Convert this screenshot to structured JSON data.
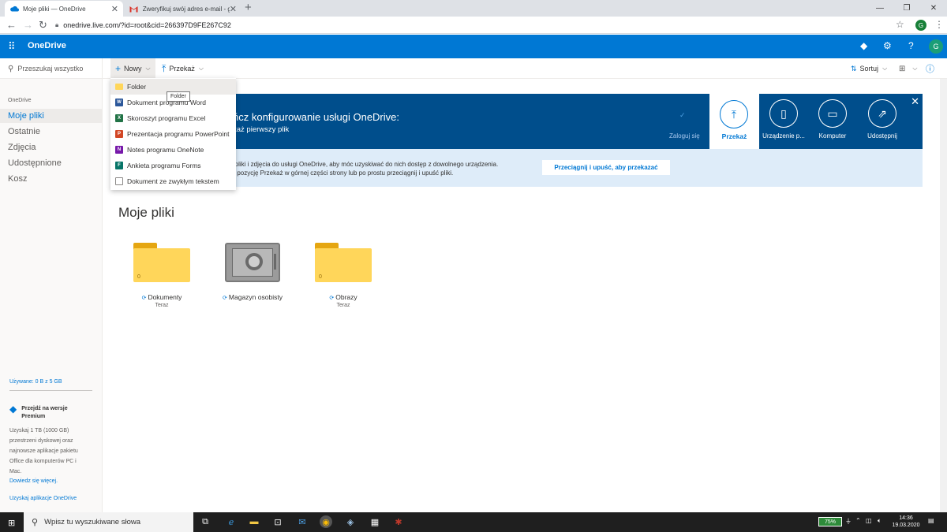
{
  "browser": {
    "tabs": [
      {
        "title": "Moje pliki — OneDrive",
        "close": "✕"
      },
      {
        "title": "Zweryfikuj swój adres e-mail - g",
        "close": "✕"
      }
    ],
    "new_tab": "+",
    "url": "onedrive.live.com/?id=root&cid=266397D9FE267C92",
    "profile_initial": "G"
  },
  "header": {
    "title": "OneDrive",
    "help": "?",
    "avatar": "G"
  },
  "commandbar": {
    "search_placeholder": "Przeszukaj wszystko",
    "new_label": "Nowy",
    "upload_label": "Przekaż",
    "sort_label": "Sortuj"
  },
  "new_menu": {
    "items": [
      {
        "label": "Folder",
        "icon": "folder-icon"
      },
      {
        "label": "Dokument programu Word",
        "icon": "word-icon"
      },
      {
        "label": "Skoroszyt programu Excel",
        "icon": "excel-icon"
      },
      {
        "label": "Prezentacja programu PowerPoint",
        "icon": "powerpoint-icon"
      },
      {
        "label": "Notes programu OneNote",
        "icon": "onenote-icon"
      },
      {
        "label": "Ankieta programu Forms",
        "icon": "forms-icon"
      },
      {
        "label": "Dokument ze zwykłym tekstem",
        "icon": "text-document-icon"
      }
    ],
    "tooltip": "Folder"
  },
  "sidebar": {
    "heading": "OneDrive",
    "items": [
      {
        "label": "Moje pliki",
        "active": true
      },
      {
        "label": "Ostatnie",
        "active": false
      },
      {
        "label": "Zdjęcia",
        "active": false
      },
      {
        "label": "Udostępnione",
        "active": false
      },
      {
        "label": "Kosz",
        "active": false
      }
    ],
    "usage": "Używane: 0 B z 5 GB",
    "premium_title": "Przejdź na wersje Premium",
    "premium_desc": "Uzyskaj 1 TB (1000 GB) przestrzeni dyskowej oraz najnowsze aplikacje pakietu Office dla komputerów PC i Mac.",
    "premium_link": "Dowiedz się więcej.",
    "apps_link": "Uzyskaj aplikacje OneDrive"
  },
  "banner": {
    "title": "ńcz konfigurowanie usługi OneDrive:",
    "subtitle": "każ pierwszy plik",
    "login": "Zaloguj się",
    "steps": [
      {
        "label": "Przekaż",
        "icon": "upload-arrow-icon"
      },
      {
        "label": "Urządzenie p...",
        "icon": "phone-icon"
      },
      {
        "label": "Komputer",
        "icon": "monitor-icon"
      },
      {
        "label": "Udostępnij",
        "icon": "share-icon"
      }
    ],
    "info_line1": "aż pliki i zdjęcia do usługi OneDrive, aby móc uzyskiwać do nich dostęp z dowolnego urządzenia.",
    "info_line2": "erz pozycję Przekaż w górnej części strony lub po prostu przeciągnij i upuść pliki.",
    "info_button": "Przeciągnij i upuść, aby przekazać"
  },
  "main": {
    "title": "Moje pliki",
    "items": [
      {
        "name": "Dokumenty",
        "date": "Teraz",
        "count": "0",
        "type": "folder"
      },
      {
        "name": "Magazyn osobisty",
        "date": "",
        "count": "",
        "type": "vault"
      },
      {
        "name": "Obrazy",
        "date": "Teraz",
        "count": "0",
        "type": "folder"
      }
    ]
  },
  "taskbar": {
    "search_placeholder": "Wpisz tu wyszukiwane słowa",
    "battery": "75%",
    "time": "14:36",
    "date": "19.03.2020"
  },
  "colors": {
    "brand": "#0078d4",
    "banner": "#004e8c",
    "infobar": "#deecf9",
    "folder": "#ffd65a"
  }
}
